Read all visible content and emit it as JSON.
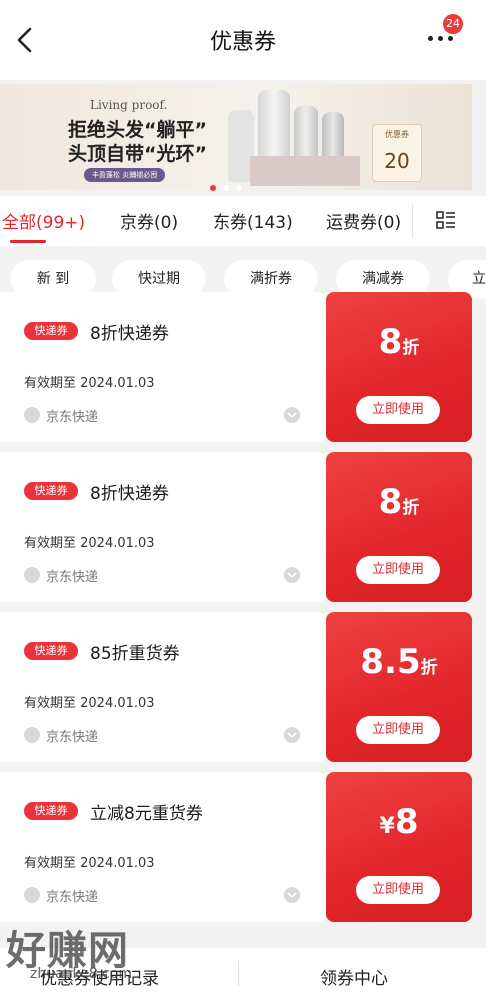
{
  "header": {
    "title": "优惠券",
    "notification_count": "24"
  },
  "banner": {
    "brand": "Living proof.",
    "slogan_line1": "拒绝头发“躺平”",
    "slogan_line2": "头顶自带“光环”",
    "tag": "丰盈蓬松 炎鋪褪必囤",
    "coupon_label": "优惠券",
    "coupon_value": "20"
  },
  "tabs": [
    {
      "label": "全部(99+)",
      "active": true
    },
    {
      "label": "京券(0)",
      "active": false
    },
    {
      "label": "东券(143)",
      "active": false
    },
    {
      "label": "运费券(0)",
      "active": false
    }
  ],
  "filters": [
    "新 到",
    "快过期",
    "满折券",
    "满减券",
    "立"
  ],
  "coupons": [
    {
      "tag": "快递券",
      "name": "8折快递券",
      "validity": "有效期至 2024.01.03",
      "merchant": "京东快递",
      "value_prefix": "",
      "value": "8",
      "unit": "折",
      "button": "立即使用"
    },
    {
      "tag": "快递券",
      "name": "8折快递券",
      "validity": "有效期至 2024.01.03",
      "merchant": "京东快递",
      "value_prefix": "",
      "value": "8",
      "unit": "折",
      "button": "立即使用"
    },
    {
      "tag": "快递券",
      "name": "85折重货券",
      "validity": "有效期至 2024.01.03",
      "merchant": "京东快递",
      "value_prefix": "",
      "value": "8.5",
      "unit": "折",
      "button": "立即使用"
    },
    {
      "tag": "快递券",
      "name": "立减8元重货券",
      "validity": "有效期至 2024.01.03",
      "merchant": "京东快递",
      "value_prefix": "¥",
      "value": "8",
      "unit": "",
      "button": "立即使用"
    }
  ],
  "bottom_bar": {
    "left": "优惠券使用记录",
    "right": "领券中心"
  },
  "watermark": {
    "text": "好赚网",
    "url": "zhuanke8.com"
  },
  "colors": {
    "accent": "#e3262b",
    "background": "#f2f2f2"
  }
}
